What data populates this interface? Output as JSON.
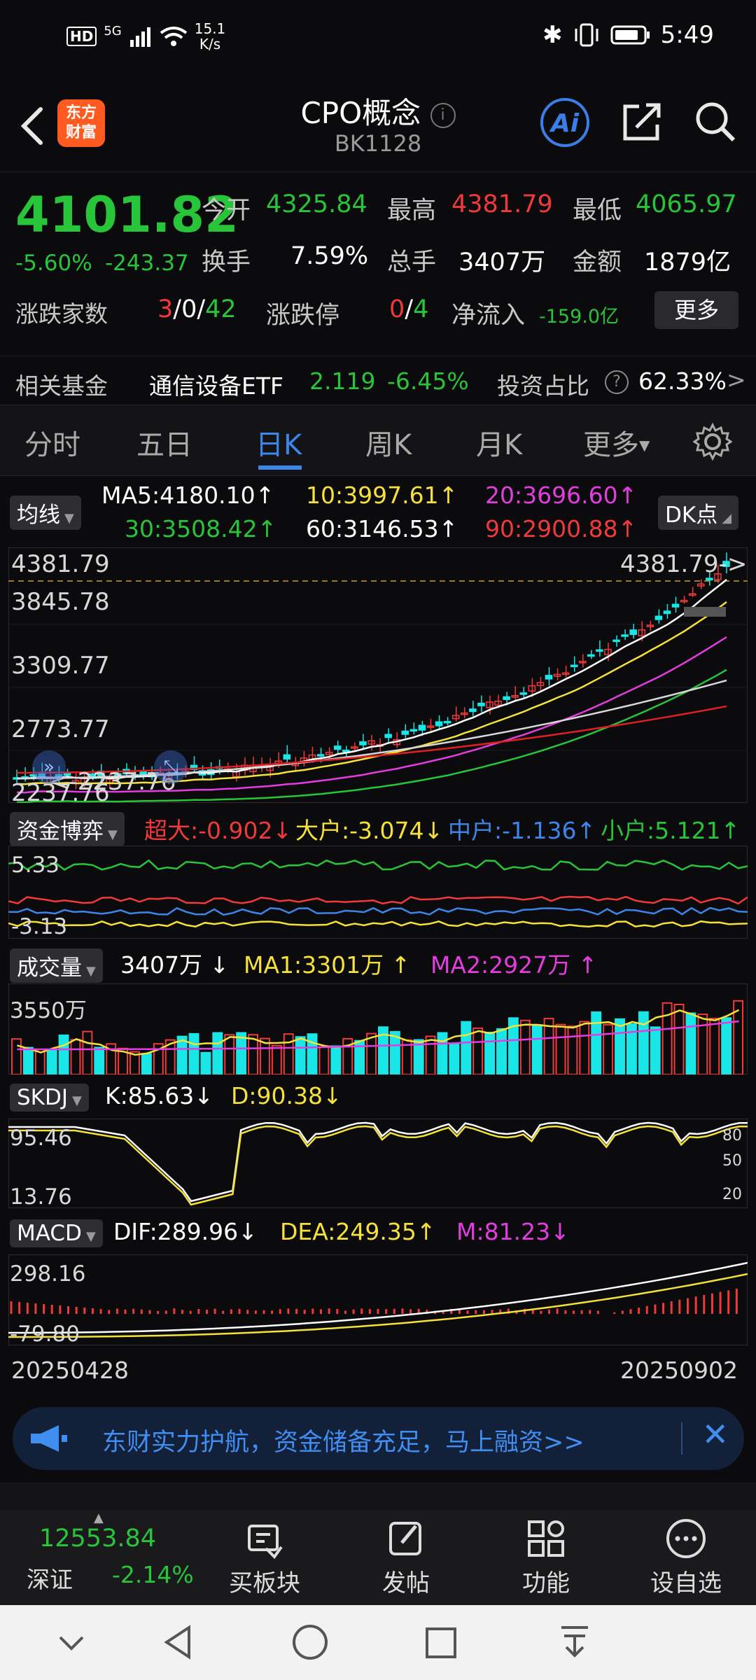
{
  "status_bar": {
    "hd": "HD",
    "network": "5G",
    "speed_top": "15.1",
    "speed_unit": "K/s",
    "time": "5:49"
  },
  "header": {
    "logo_line1": "东方",
    "logo_line2": "财富",
    "title": "CPO概念",
    "code": "BK1128",
    "ai_label": "Ai"
  },
  "quote": {
    "price": "4101.82",
    "change_pct": "-5.60%",
    "change_abs": "-243.37",
    "open_label": "今开",
    "open": "4325.84",
    "high_label": "最高",
    "high": "4381.79",
    "low_label": "最低",
    "low": "4065.97",
    "turnover_label": "换手",
    "turnover": "7.59%",
    "volume_label": "总手",
    "volume": "3407万",
    "amount_label": "金额",
    "amount": "1879亿",
    "updown_label": "涨跌家数",
    "up": "3",
    "flat": "0",
    "down": "42",
    "limit_label": "涨跌停",
    "limit_up": "0",
    "limit_down": "4",
    "inflow_label": "净流入",
    "inflow": "-159.0亿",
    "more": "更多"
  },
  "fund": {
    "label": "相关基金",
    "name": "通信设备ETF",
    "price": "2.119",
    "pct": "-6.45%",
    "ratio_label": "投资占比",
    "ratio": "62.33%"
  },
  "tabs": [
    "分时",
    "五日",
    "日K",
    "周K",
    "月K",
    "更多",
    "gear-icon"
  ],
  "ma_legend": {
    "pill": "均线",
    "ma5": "MA5:4180.10",
    "ma10": "10:3997.61",
    "ma20": "20:3696.60",
    "ma30": "30:3508.42",
    "ma60": "60:3146.53",
    "ma90": "90:2900.88",
    "dk": "DK点"
  },
  "kline": {
    "y1": "4381.79",
    "y2": "3845.78",
    "y3": "3309.77",
    "y4": "2773.77",
    "y5": "2237.76",
    "high_marker": "4381.79",
    "low_marker": "2237.76"
  },
  "capital": {
    "pill": "资金博弈",
    "super": "超大:-0.902",
    "large": "大户:-3.074",
    "mid": "中户:-1.136",
    "small": "小户:5.121",
    "y_top": "5.33",
    "y_bottom": "-3.13"
  },
  "volume": {
    "pill": "成交量",
    "vol": "3407万",
    "ma1": "MA1:3301万",
    "ma2": "MA2:2927万",
    "y_top": "3550万"
  },
  "skdj": {
    "pill": "SKDJ",
    "k": "K:85.63",
    "d": "D:90.38",
    "y_top": "95.46",
    "y_bottom": "13.76",
    "r80": "80",
    "r50": "50",
    "r20": "20"
  },
  "macd": {
    "pill": "MACD",
    "dif": "DIF:289.96",
    "dea": "DEA:249.35",
    "m": "M:81.23",
    "y_top": "298.16",
    "y_bottom": "-79.80"
  },
  "dates": {
    "start": "20250428",
    "end": "20250902"
  },
  "banner": {
    "text": "东财实力护航，资金储备充足，马上融资>>"
  },
  "toolbar": {
    "index_value": "12553.84",
    "index_name": "深证",
    "index_pct": "-2.14%",
    "item1": "买板块",
    "item2": "发帖",
    "item3": "功能",
    "item4": "设自选"
  },
  "colors": {
    "up": "#f03a3a",
    "down": "#28c43a",
    "accent": "#3b86e8",
    "ma5": "#ffffff",
    "ma10": "#f5e13a",
    "ma20": "#e33de0",
    "ma30": "#28c43a",
    "ma60": "#d8d8d8",
    "ma90": "#e02020",
    "vol_down": "#19e6e6"
  }
}
